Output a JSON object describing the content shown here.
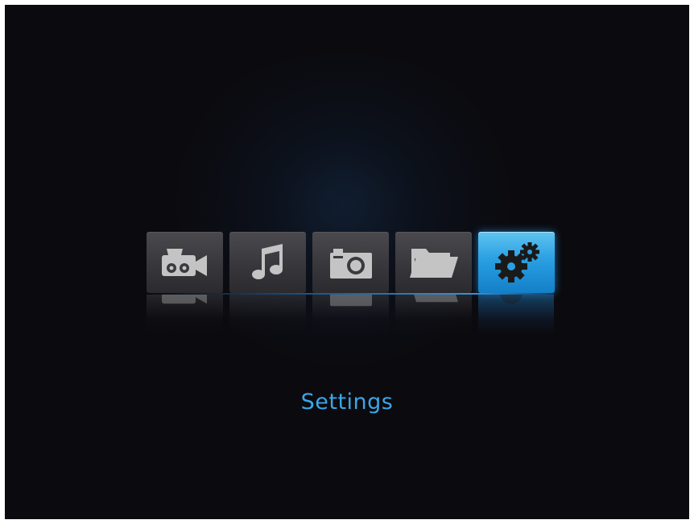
{
  "menu": {
    "items": [
      {
        "id": "video",
        "icon": "video-camera-icon",
        "selected": false
      },
      {
        "id": "music",
        "icon": "music-note-icon",
        "selected": false
      },
      {
        "id": "photo",
        "icon": "camera-icon",
        "selected": false
      },
      {
        "id": "files",
        "icon": "folder-icon",
        "selected": false
      },
      {
        "id": "settings",
        "icon": "gears-icon",
        "selected": true
      }
    ],
    "selected_label": "Settings"
  },
  "colors": {
    "background": "#0b0a0e",
    "tile": "#3a393d",
    "accent": "#2a9fe2",
    "label": "#3aa6e8",
    "icon": "#bdbdbd"
  }
}
